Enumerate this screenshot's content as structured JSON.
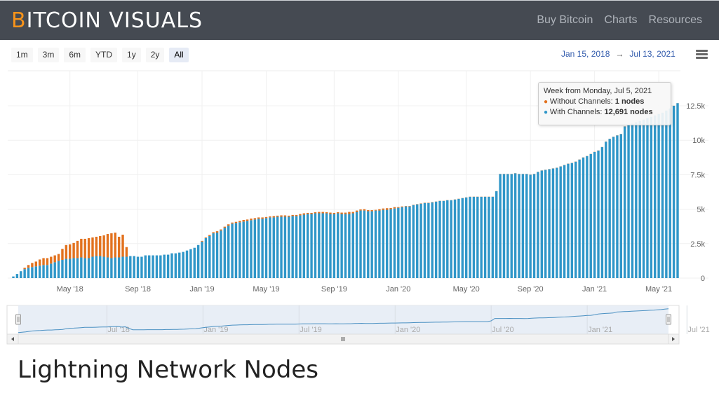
{
  "header": {
    "logo_first": "B",
    "logo_rest": "ITCOIN VISUALS",
    "nav": [
      "Buy Bitcoin",
      "Charts",
      "Resources"
    ]
  },
  "range_selector": {
    "buttons": [
      "1m",
      "3m",
      "6m",
      "YTD",
      "1y",
      "2y",
      "All"
    ],
    "active": "All",
    "from": "Jan 15, 2018",
    "arrow": "→",
    "to": "Jul 13, 2021"
  },
  "tooltip": {
    "title": "Week from Monday, Jul 5, 2021",
    "line1_label": "Without Channels: ",
    "line1_value": "1 nodes",
    "line2_label": "With Channels: ",
    "line2_value": "12,691 nodes"
  },
  "page_title": "Lightning Network Nodes",
  "colors": {
    "with": "#2f96c8",
    "without": "#e2711d",
    "navigator_line": "#4a90c2"
  },
  "chart_data": {
    "type": "bar",
    "stacked": true,
    "title": "Lightning Network Nodes",
    "xlabel": "",
    "ylabel": "",
    "ylim": [
      0,
      12500
    ],
    "yticks": [
      "0",
      "2.5k",
      "5k",
      "7.5k",
      "10k",
      "12.5k"
    ],
    "ytick_values": [
      0,
      2500,
      5000,
      7500,
      10000,
      12500
    ],
    "xticks": [
      "May '18",
      "Sep '18",
      "Jan '19",
      "May '19",
      "Sep '19",
      "Jan '20",
      "May '20",
      "Sep '20",
      "Jan '21",
      "May '21"
    ],
    "xtick_week_index": [
      15,
      33,
      50,
      67,
      85,
      102,
      120,
      137,
      154,
      171
    ],
    "navigator_ticks": [
      "Jul '18",
      "Jan '19",
      "Jul '19",
      "Jan '20",
      "Jul '20",
      "Jan '21",
      "Jul '21"
    ],
    "navigator_tick_week_index": [
      24,
      50,
      76,
      102,
      128,
      154,
      181
    ],
    "first_week": "2018-01-15",
    "last_week": "2021-07-05",
    "interval": "weekly",
    "grid": true,
    "legend": "none",
    "series": [
      {
        "name": "With Channels",
        "values": [
          120,
          300,
          500,
          650,
          750,
          800,
          850,
          900,
          950,
          950,
          1050,
          1150,
          1250,
          1320,
          1400,
          1400,
          1450,
          1450,
          1500,
          1450,
          1450,
          1550,
          1600,
          1600,
          1550,
          1500,
          1450,
          1500,
          1500,
          1550,
          1550,
          1600,
          1600,
          1550,
          1550,
          1650,
          1650,
          1650,
          1650,
          1650,
          1700,
          1700,
          1800,
          1800,
          1850,
          1900,
          2000,
          2100,
          2200,
          2400,
          2650,
          2900,
          3050,
          3250,
          3300,
          3450,
          3650,
          3800,
          3950,
          4000,
          4050,
          4100,
          4150,
          4200,
          4250,
          4300,
          4300,
          4350,
          4400,
          4400,
          4450,
          4450,
          4450,
          4450,
          4500,
          4500,
          4550,
          4600,
          4650,
          4650,
          4700,
          4700,
          4700,
          4700,
          4650,
          4650,
          4700,
          4650,
          4650,
          4650,
          4700,
          4800,
          4900,
          4900,
          4850,
          4850,
          4900,
          4900,
          4950,
          4950,
          5000,
          5050,
          5100,
          5150,
          5200,
          5200,
          5300,
          5350,
          5400,
          5450,
          5450,
          5500,
          5550,
          5600,
          5600,
          5650,
          5650,
          5700,
          5750,
          5800,
          5850,
          5900,
          5900,
          5900,
          5900,
          5900,
          5900,
          5900,
          6300,
          7550,
          7550,
          7550,
          7550,
          7600,
          7550,
          7550,
          7550,
          7500,
          7550,
          7700,
          7800,
          7850,
          7900,
          7950,
          8000,
          8100,
          8200,
          8300,
          8350,
          8450,
          8600,
          8750,
          8850,
          9000,
          9150,
          9250,
          9500,
          9900,
          10100,
          10250,
          10350,
          10450,
          11000,
          11100,
          11200,
          11300,
          11400,
          11500,
          11600,
          11700,
          11800,
          11900,
          12000,
          12150,
          12300,
          12500,
          12691
        ]
      },
      {
        "name": "Without Channels",
        "values": [
          0,
          0,
          0,
          100,
          200,
          300,
          350,
          450,
          500,
          500,
          500,
          500,
          500,
          800,
          1000,
          1050,
          1100,
          1250,
          1350,
          1400,
          1450,
          1400,
          1400,
          1450,
          1550,
          1700,
          1800,
          1800,
          1500,
          1600,
          700,
          0,
          0,
          0,
          0,
          0,
          0,
          0,
          0,
          0,
          0,
          0,
          0,
          0,
          0,
          0,
          0,
          0,
          0,
          0,
          50,
          50,
          80,
          80,
          100,
          80,
          80,
          100,
          80,
          80,
          100,
          120,
          100,
          120,
          100,
          100,
          100,
          80,
          80,
          100,
          80,
          100,
          100,
          80,
          80,
          80,
          100,
          100,
          80,
          80,
          80,
          100,
          100,
          80,
          100,
          80,
          80,
          100,
          100,
          150,
          100,
          100,
          80,
          100,
          80,
          80,
          50,
          100,
          100,
          120,
          80,
          100,
          50,
          50,
          30,
          30,
          20,
          20,
          20,
          20,
          20,
          20,
          10,
          10,
          10,
          10,
          10,
          10,
          10,
          10,
          10,
          10,
          10,
          10,
          10,
          10,
          10,
          10,
          10,
          10,
          10,
          10,
          10,
          10,
          10,
          10,
          10,
          10,
          10,
          10,
          10,
          10,
          10,
          10,
          10,
          10,
          10,
          10,
          10,
          10,
          10,
          10,
          10,
          10,
          10,
          10,
          10,
          10,
          10,
          10,
          10,
          10,
          10,
          10,
          5,
          5,
          5,
          5,
          5,
          5,
          5,
          5,
          5,
          5,
          5,
          5,
          5,
          5,
          5,
          5,
          5,
          1,
          1,
          1
        ]
      }
    ]
  }
}
